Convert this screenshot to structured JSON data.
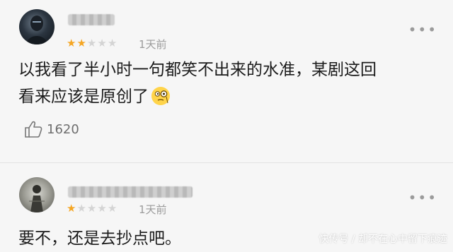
{
  "comments": [
    {
      "rating": 2,
      "max_rating": 5,
      "time": "1天前",
      "content_line1": "以我看了半小时一句都笑不出来的水准，某剧这回",
      "content_line2": "看来应该是原创了",
      "likes": "1620",
      "more_label": "•••"
    },
    {
      "rating": 1,
      "max_rating": 5,
      "time": "1天前",
      "content_line1": "要不，还是去抄点吧。",
      "more_label": "•••"
    }
  ],
  "watermark": "快传号 / 却不在心中留下痕迹",
  "colors": {
    "star_active": "#f5a623",
    "star_inactive": "#d4d4d4",
    "meta_text": "#9b9b9b"
  }
}
